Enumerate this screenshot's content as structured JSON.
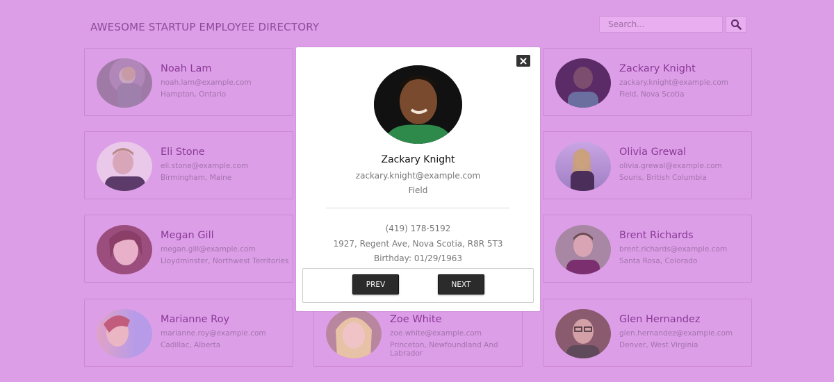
{
  "header": {
    "title": "AWESOME STARTUP EMPLOYEE DIRECTORY",
    "search_placeholder": "Search..."
  },
  "icons": {
    "search": "search-icon",
    "close": "close-icon"
  },
  "colors": {
    "overlay_background": "#dd9ee8",
    "name_text": "#8a3a97",
    "button_dark": "#2b2b2b"
  },
  "employees": [
    {
      "name": "Noah Lam",
      "email": "noah.lam@example.com",
      "location": "Hampton, Ontario"
    },
    {
      "name": "Zackary Knight",
      "email": "zackary.knight@example.com",
      "location": "Field, Nova Scotia"
    },
    {
      "name": "Eli Stone",
      "email": "eli.stone@example.com",
      "location": "Birmingham, Maine"
    },
    {
      "name": "Olivia Grewal",
      "email": "olivia.grewal@example.com",
      "location": "Souris, British Columbia"
    },
    {
      "name": "Megan Gill",
      "email": "megan.gill@example.com",
      "location": "Lloydminster, Northwest Territories"
    },
    {
      "name": "Brent Richards",
      "email": "brent.richards@example.com",
      "location": "Santa Rosa, Colorado"
    },
    {
      "name": "Marianne Roy",
      "email": "marianne.roy@example.com",
      "location": "Cadillac, Alberta"
    },
    {
      "name": "Zoe White",
      "email": "zoe.white@example.com",
      "location": "Princeton, Newfoundland And Labrador"
    },
    {
      "name": "Glen Hernandez",
      "email": "glen.hernandez@example.com",
      "location": "Denver, West Virginia"
    }
  ],
  "modal": {
    "name": "Zackary Knight",
    "email": "zackary.knight@example.com",
    "city": "Field",
    "phone": "(419) 178-5192",
    "address": "1927, Regent Ave, Nova Scotia, R8R 5T3",
    "birthday": "Birthday: 01/29/1963",
    "close_label": "X",
    "prev_label": "PREV",
    "next_label": "NEXT"
  }
}
